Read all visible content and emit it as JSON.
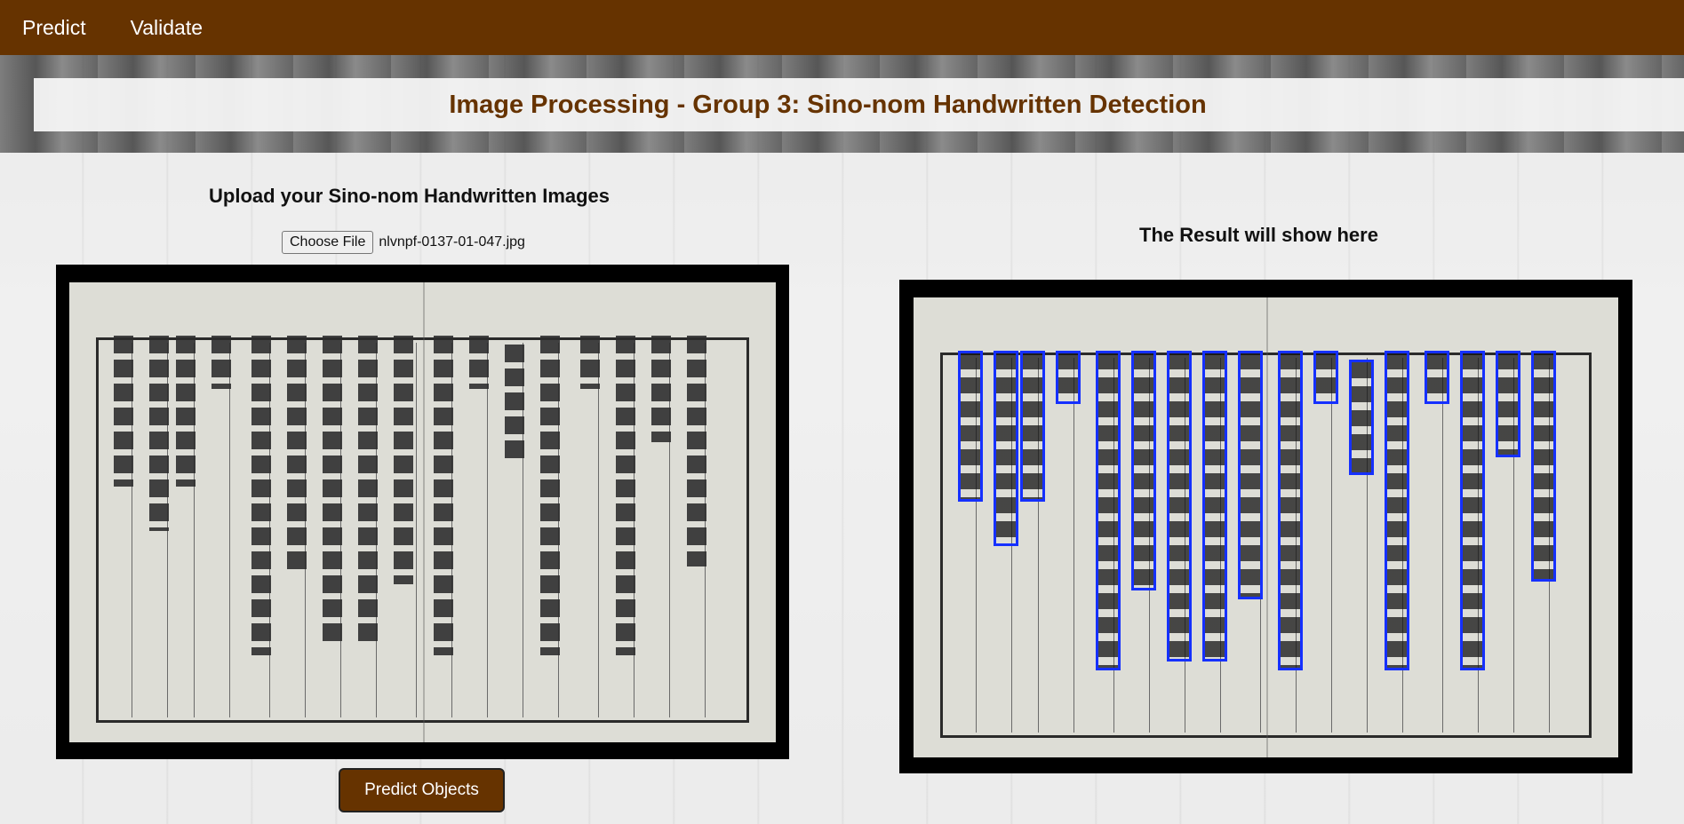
{
  "nav": {
    "items": [
      {
        "label": "Predict"
      },
      {
        "label": "Validate"
      }
    ]
  },
  "header": {
    "title": "Image Processing - Group 3: Sino-nom Handwritten Detection"
  },
  "upload": {
    "heading": "Upload your Sino-nom Handwritten Images",
    "choose_file_label": "Choose File",
    "file_name": "nlvnpf-0137-01-047.jpg"
  },
  "result": {
    "heading": "The Result will show here"
  },
  "actions": {
    "predict_label": "Predict Objects"
  },
  "colors": {
    "brand": "#663300",
    "detection_box": "#1530ff"
  }
}
